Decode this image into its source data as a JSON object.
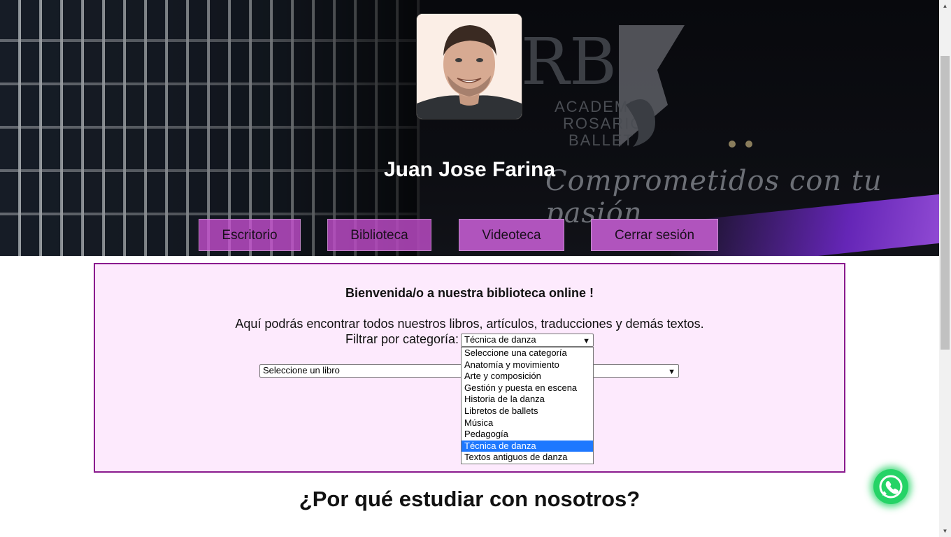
{
  "profile": {
    "name": "Juan Jose Farina",
    "avatar_alt": "profile-photo"
  },
  "hero": {
    "logo_letters": "RB",
    "logo_lines": [
      "ACADEMIA",
      "ROSARIO",
      "BALLET"
    ],
    "tagline": "Comprometidos con tu pasión"
  },
  "nav": {
    "items": [
      {
        "label": "Escritorio"
      },
      {
        "label": "Biblioteca"
      },
      {
        "label": "Videoteca"
      },
      {
        "label": "Cerrar sesión"
      }
    ]
  },
  "library": {
    "welcome": "Bienvenida/o a nuestra biblioteca online !",
    "intro": "Aquí podrás encontrar todos nuestros libros, artículos, traducciones y demás textos.",
    "filter_label": "Filtrar por categoría:",
    "category_selected": "Técnica de danza",
    "category_options": [
      "Seleccione una categoría",
      "Anatomía y movimiento",
      "Arte y composición",
      "Gestión y puesta en escena",
      "Historia de la danza",
      "Libretos de ballets",
      "Música",
      "Pedagogía",
      "Técnica de danza",
      "Textos antiguos de danza"
    ],
    "book_select": "Seleccione un libro"
  },
  "section": {
    "heading": "¿Por qué estudiar con nosotros?"
  },
  "icons": {
    "chevron": "chevron-down-icon",
    "whatsapp": "whatsapp-icon"
  },
  "colors": {
    "accent": "#b054bd",
    "panel_bg": "#fdeafd",
    "panel_border": "#8a1a8e",
    "selected_option": "#1e78ff",
    "whatsapp": "#25d366"
  }
}
